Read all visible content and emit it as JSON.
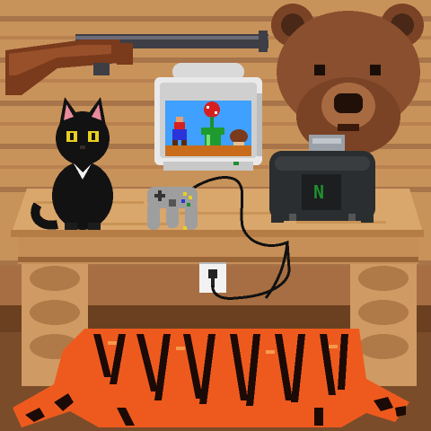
{
  "scene": {
    "objects": [
      "wooden-wall",
      "mounted-rifle",
      "bear-head-trophy",
      "black-cat",
      "crt-monitor",
      "game-controller",
      "game-console",
      "wall-outlet",
      "wooden-table",
      "tiger-skin-rug"
    ]
  },
  "console": {
    "logo_letter": "N",
    "logo_color": "#1e8f2e"
  },
  "monitor_screen": {
    "characters": [
      "red-plumber-sprite",
      "piranha-plant-sprite",
      "green-pipe",
      "brown-mushroom-enemy"
    ],
    "sky_color": "#3fa0ff",
    "ground_color": "#c86c1c"
  },
  "colors": {
    "wall_wood": "#c8935a",
    "wall_plank_dark": "#a8744a",
    "table_top": "#d9a66b",
    "rifle_stock": "#7a3a1c",
    "rifle_barrel": "#3e3e46",
    "bear_fur": "#8a4f2e",
    "cat_fur": "#121212",
    "cat_eyes": "#e8d020",
    "rug_orange": "#ee5a1e",
    "console_body": "#2b2e30"
  }
}
